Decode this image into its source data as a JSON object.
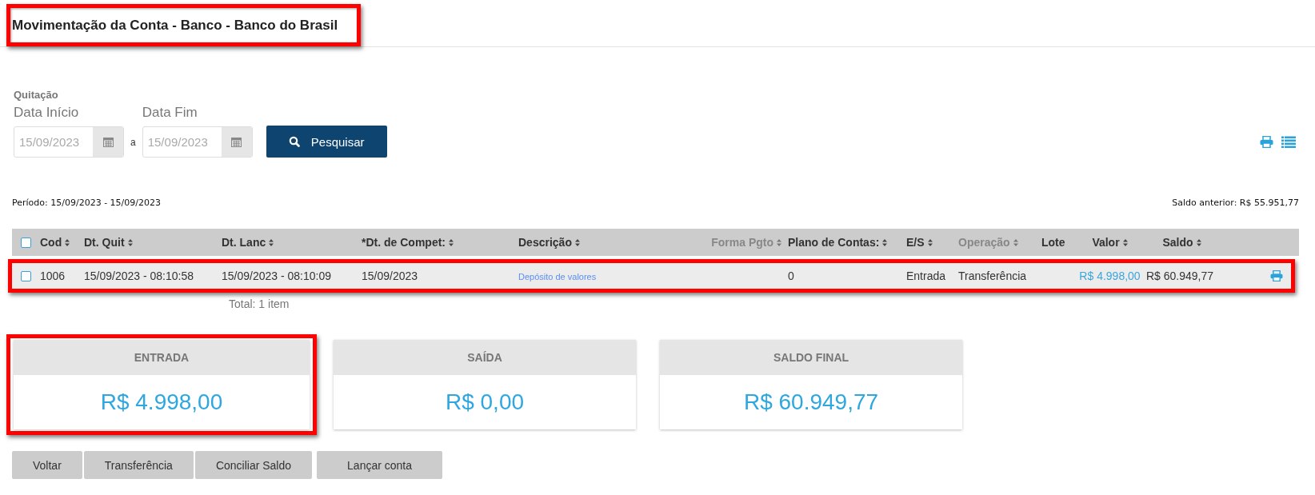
{
  "page": {
    "title": "Movimentação da Conta - Banco - Banco do Brasil",
    "highlighted": true
  },
  "filter": {
    "group_label": "Quitação",
    "fields": [
      {
        "label": "Data Início",
        "value": "15/09/2023"
      },
      {
        "label": "Data Fim",
        "value": "15/09/2023"
      }
    ],
    "separator": "a",
    "search_button": "Pesquisar"
  },
  "period": "Período: 15/09/2023 - 15/09/2023",
  "previous_balance": "Saldo anterior: R$ 55.951,77",
  "table": {
    "header_checked": false,
    "columns": [
      {
        "label": "Cod",
        "sortable": true,
        "muted": false
      },
      {
        "label": "Dt. Quit",
        "sortable": true,
        "muted": false
      },
      {
        "label": "Dt. Lanc",
        "sortable": true,
        "muted": false
      },
      {
        "label": "*Dt. de Compet:",
        "sortable": true,
        "muted": false
      },
      {
        "label": "Descrição",
        "sortable": true,
        "muted": false
      },
      {
        "label": "Forma Pgto",
        "sortable": true,
        "muted": true
      },
      {
        "label": "Plano de Contas:",
        "sortable": true,
        "muted": false
      },
      {
        "label": "E/S",
        "sortable": true,
        "muted": false
      },
      {
        "label": "Operação",
        "sortable": true,
        "muted": true
      },
      {
        "label": "Lote",
        "sortable": false,
        "muted": false
      },
      {
        "label": "Valor",
        "sortable": true,
        "muted": false
      },
      {
        "label": "Saldo",
        "sortable": true,
        "muted": false
      }
    ],
    "rows": [
      {
        "checked": false,
        "highlighted": true,
        "cells": [
          {
            "kind": "text",
            "text": "1006"
          },
          {
            "kind": "text",
            "text": "15/09/2023 - 08:10:58"
          },
          {
            "kind": "text",
            "text": "15/09/2023 - 08:10:09"
          },
          {
            "kind": "text",
            "text": "15/09/2023"
          },
          {
            "kind": "link",
            "text": "Depósito de valores"
          },
          {
            "kind": "empty"
          },
          {
            "kind": "text",
            "text": "0"
          },
          {
            "kind": "text",
            "text": "Entrada"
          },
          {
            "kind": "text",
            "text": "Transferência"
          },
          {
            "kind": "empty"
          },
          {
            "kind": "amount",
            "text": "R$ 4.998,00"
          },
          {
            "kind": "text",
            "text": "R$ 60.949,77"
          }
        ]
      }
    ],
    "total": "Total: 1 item"
  },
  "summary": [
    {
      "title": "ENTRADA",
      "value": "R$ 4.998,00",
      "highlighted": true
    },
    {
      "title": "SAÍDA",
      "value": "R$ 0,00",
      "highlighted": false
    },
    {
      "title": "SALDO FINAL",
      "value": "R$ 60.949,77",
      "highlighted": false
    }
  ],
  "buttons": [
    "Voltar",
    "Transferência",
    "Conciliar Saldo",
    "Lançar conta"
  ]
}
